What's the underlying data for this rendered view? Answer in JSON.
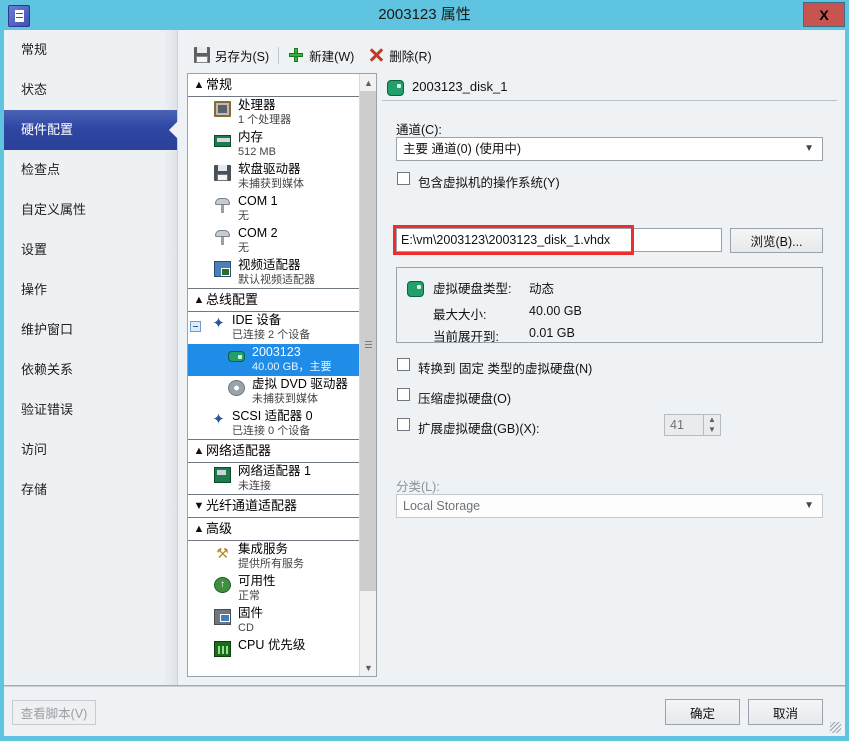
{
  "window": {
    "title": "2003123 属性",
    "icon": "vm-properties-icon",
    "close_label": "X"
  },
  "sidebar": {
    "items": [
      {
        "label": "常规",
        "selected": false
      },
      {
        "label": "状态",
        "selected": false
      },
      {
        "label": "硬件配置",
        "selected": true
      },
      {
        "label": "检查点",
        "selected": false
      },
      {
        "label": "自定义属性",
        "selected": false
      },
      {
        "label": "设置",
        "selected": false
      },
      {
        "label": "操作",
        "selected": false
      },
      {
        "label": "维护窗口",
        "selected": false
      },
      {
        "label": "依赖关系",
        "selected": false
      },
      {
        "label": "验证错误",
        "selected": false
      },
      {
        "label": "访问",
        "selected": false
      },
      {
        "label": "存储",
        "selected": false
      }
    ]
  },
  "toolbar": {
    "save_as": "另存为(S)",
    "new": "新建(W)",
    "delete": "删除(R)"
  },
  "tree": {
    "groups": [
      {
        "label": "常规",
        "expanded": true,
        "nodes": [
          {
            "title": "处理器",
            "sub": "1 个处理器",
            "icon": "cpu-icon",
            "selected": false
          },
          {
            "title": "内存",
            "sub": "512 MB",
            "icon": "memory-icon",
            "selected": false
          },
          {
            "title": "软盘驱动器",
            "sub": "未捕获到媒体",
            "icon": "floppy-icon",
            "selected": false
          },
          {
            "title": "COM 1",
            "sub": "无",
            "icon": "com-port-icon",
            "selected": false
          },
          {
            "title": "COM 2",
            "sub": "无",
            "icon": "com-port-icon",
            "selected": false
          },
          {
            "title": "视频适配器",
            "sub": "默认视频适配器",
            "icon": "video-adapter-icon",
            "selected": false
          }
        ]
      },
      {
        "label": "总线配置",
        "expanded": true,
        "nodes": [
          {
            "title": "IDE 设备",
            "sub": "已连接 2 个设备",
            "icon": "ide-device-icon",
            "selected": false,
            "expander": true
          },
          {
            "title": "2003123",
            "sub": "40.00 GB，主要",
            "icon": "hard-disk-icon",
            "selected": true,
            "indent": true
          },
          {
            "title": "虚拟 DVD 驱动器",
            "sub": "未捕获到媒体",
            "icon": "dvd-drive-icon",
            "selected": false,
            "indent": true
          },
          {
            "title": "SCSI 适配器 0",
            "sub": "已连接 0 个设备",
            "icon": "scsi-adapter-icon",
            "selected": false
          }
        ]
      },
      {
        "label": "网络适配器",
        "expanded": true,
        "nodes": [
          {
            "title": "网络适配器 1",
            "sub": "未连接",
            "icon": "network-adapter-icon",
            "selected": false
          }
        ]
      },
      {
        "label": "光纤通道适配器",
        "expanded": false,
        "nodes": []
      },
      {
        "label": "高级",
        "expanded": true,
        "nodes": [
          {
            "title": "集成服务",
            "sub": "提供所有服务",
            "icon": "integration-services-icon",
            "selected": false
          },
          {
            "title": "可用性",
            "sub": "正常",
            "icon": "availability-icon",
            "selected": false
          },
          {
            "title": "固件",
            "sub": "CD",
            "icon": "firmware-icon",
            "selected": false
          },
          {
            "title": "CPU 优先级",
            "sub": "",
            "icon": "cpu-priority-icon",
            "selected": false
          }
        ]
      }
    ]
  },
  "detail": {
    "header": "2003123_disk_1",
    "channel_label": "通道(C):",
    "channel_value": "主要 通道(0) (使用中)",
    "contains_os_label": "包含虚拟机的操作系统(Y)",
    "contains_os_checked": false,
    "file_path": "E:\\vm\\2003123\\2003123_disk_1.vhdx",
    "browse_label": "浏览(B)...",
    "info": {
      "type_label": "虚拟硬盘类型:",
      "type_value": "动态",
      "max_size_label": "最大大小:",
      "max_size_value": "40.00 GB",
      "expanded_label": "当前展开到:",
      "expanded_value": "0.01 GB"
    },
    "convert_label": "转换到 固定 类型的虚拟硬盘(N)",
    "convert_checked": false,
    "compact_label": "压缩虚拟硬盘(O)",
    "compact_checked": false,
    "expand_label": "扩展虚拟硬盘(GB)(X):",
    "expand_checked": false,
    "expand_value": "41",
    "classification_label": "分类(L):",
    "classification_value": "Local Storage"
  },
  "footer": {
    "view_script": "查看脚本(V)",
    "ok": "确定",
    "cancel": "取消"
  },
  "colors": {
    "title_bar": "#5ec4e0",
    "accent_selected": "#2f47a3",
    "tree_selection": "#1f8ce8",
    "highlight_red": "#ef2d2d",
    "close_button": "#c75450"
  }
}
